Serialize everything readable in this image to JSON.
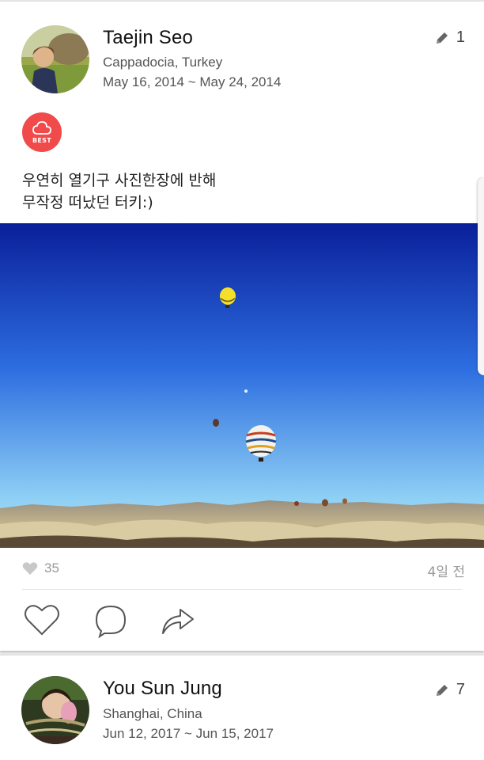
{
  "posts": [
    {
      "author": "Taejin Seo",
      "location": "Cappadocia, Turkey",
      "dates": "May 16, 2014 ~ May 24, 2014",
      "edit_count": "1",
      "badge": "BEST",
      "caption_line1": "우연히 열기구 사진한장에 반해",
      "caption_line2": "무작정 떠났던 터키:)",
      "likes": "35",
      "time_ago": "4일 전",
      "photo_icon": "hot-air-balloon-photo",
      "actions": [
        "heart-icon",
        "comment-icon",
        "share-icon"
      ]
    },
    {
      "author": "You Sun  Jung",
      "location": "Shanghai, China",
      "dates": "Jun 12, 2017 ~ Jun 15, 2017",
      "edit_count": "7"
    }
  ],
  "colors": {
    "badge": "#f04a4a",
    "sky_top": "#0a1f9a",
    "sky_bottom": "#8fd0f5",
    "meta_text": "#555555",
    "muted_text": "#999999"
  }
}
